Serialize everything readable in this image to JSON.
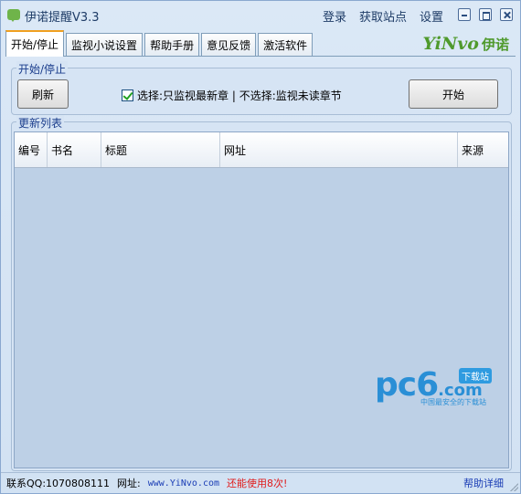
{
  "window": {
    "title": "伊诺提醒V3.3"
  },
  "top_links": {
    "login": "登录",
    "get_sites": "获取站点",
    "settings": "设置"
  },
  "tabs": [
    {
      "label": "开始/停止",
      "active": true
    },
    {
      "label": "监视小说设置",
      "active": false
    },
    {
      "label": "帮助手册",
      "active": false
    },
    {
      "label": "意见反馈",
      "active": false
    },
    {
      "label": "激活软件",
      "active": false
    }
  ],
  "logo": {
    "latin": "YiNvo",
    "chinese": "伊诺",
    "color": "#4f9a2c"
  },
  "start_stop_group": {
    "title": "开始/停止",
    "refresh_label": "刷新",
    "checkbox_checked": true,
    "checkbox_label": "选择:只监视最新章 | 不选择:监视未读章节",
    "start_label": "开始"
  },
  "update_list": {
    "title": "更新列表",
    "columns": [
      "编号",
      "书名",
      "标题",
      "网址",
      "来源"
    ],
    "rows": []
  },
  "watermark": {
    "brand": "pc6",
    "domain": ".com",
    "badge": "下载站",
    "tagline": "中国最安全的下载站"
  },
  "status_bar": {
    "contact": "联系QQ:1070808111",
    "site_label": "网址:",
    "site": "www.YiNvo.com",
    "trial": "还能使用8次!",
    "help": "帮助详细"
  },
  "icons": [
    "app-icon",
    "minimize-icon",
    "maximize-icon",
    "close-icon",
    "checkmark-icon"
  ]
}
